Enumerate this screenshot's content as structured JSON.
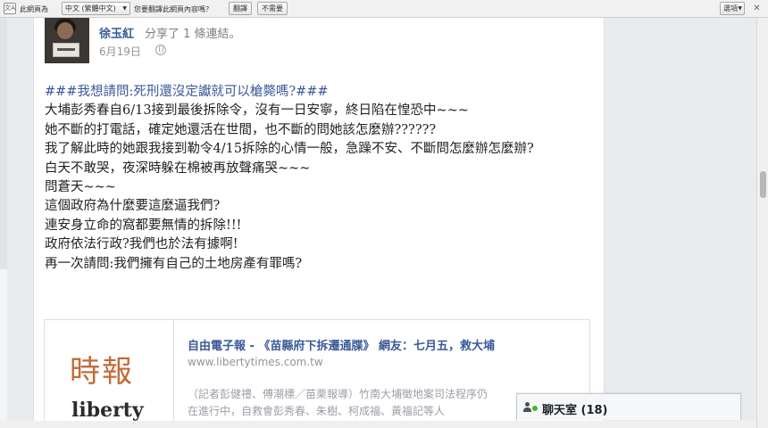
{
  "translate_bar": {
    "label": "此網頁為",
    "language": "中文 (繁體中文)",
    "question": "您要翻譯此網頁內容嗎？",
    "translate_button": "翻譯",
    "nope_button": "不需要",
    "options_button": "選項",
    "close_icon": "close-icon"
  },
  "post": {
    "author": "徐玉紅",
    "shared_text": "分享了 1 條連結。",
    "date": "6月19日",
    "privacy_icon": "globe-icon",
    "lines": [
      "###我想請問:死刑還沒定讞就可以槍斃嗎?###",
      "大埔彭秀春自6/13接到最後拆除令，沒有一日安寧，終日陷在惶恐中~~~",
      "她不斷的打電話，確定她還活在世間，也不斷的問她該怎麼辦??????",
      "我了解此時的她跟我接到勒令4/15拆除的心情一般，急躁不安、不斷問怎麼辦怎麼辦?",
      "白天不敢哭，夜深時躲在棉被再放聲痛哭~~~",
      "問蒼天~~~",
      "這個政府為什麼要這麼逼我們?",
      "連安身立命的窩都要無情的拆除!!!",
      "政府依法行政?我們也於法有據啊!",
      "再一次請問:我們擁有自己的土地房產有罪嗎?"
    ]
  },
  "preview": {
    "logo_text": "時報",
    "logo_sub": "liberty",
    "title": "自由電子報 - 《苗縣府下拆遷通牒》 網友：七月五，救大埔",
    "url": "www.libertytimes.com.tw",
    "desc_1": "（記者彭健禮、傅潮標／苗栗報導）竹南大埔徵地案司法程序仍",
    "desc_2": "在進行中，自救會彭秀春、朱樹、柯成福、黃福記等人"
  },
  "chat": {
    "label": "聊天室 (18)",
    "status_color": "#42b72a"
  }
}
